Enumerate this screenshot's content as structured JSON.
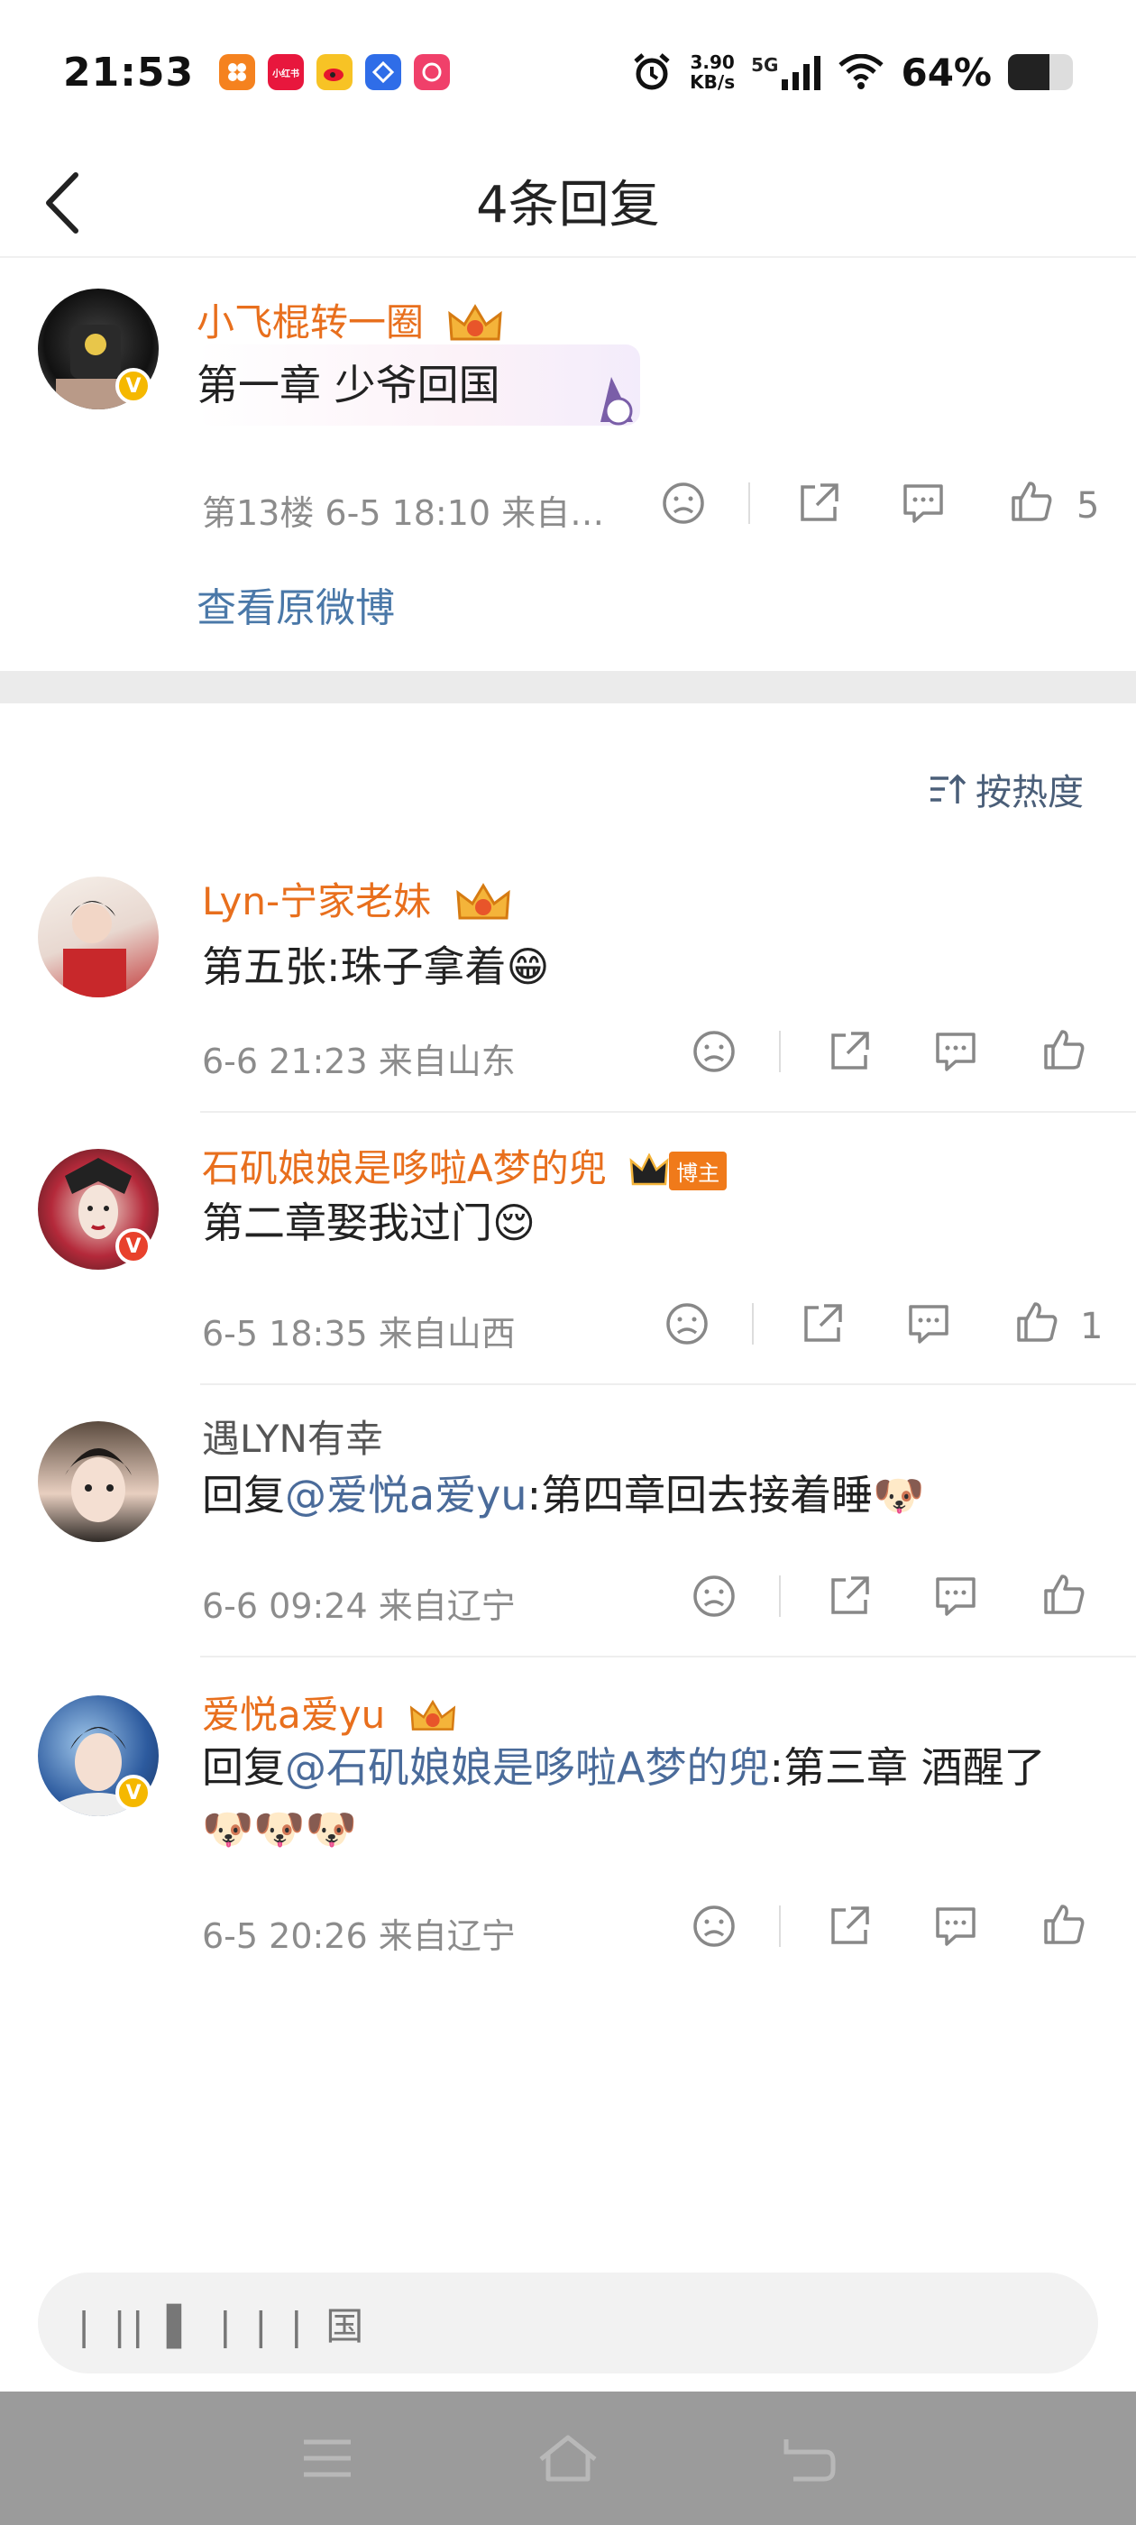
{
  "status_bar": {
    "time": "21:53",
    "net_speed_top": "3.90",
    "net_speed_bottom": "KB/s",
    "network": "5G",
    "battery": "64%",
    "battery_level": 0.64,
    "apps": [
      {
        "icon": "taobao-app-icon",
        "label": "",
        "color": "#f5821f"
      },
      {
        "icon": "xiaohongshu-app-icon",
        "label": "小红书",
        "color": "#e8173d"
      },
      {
        "icon": "weibo-app-icon",
        "label": "",
        "color": "#f7c325"
      },
      {
        "icon": "blue-app-icon",
        "label": "",
        "color": "#2f6de8"
      },
      {
        "icon": "pink-app-icon",
        "label": "",
        "color": "#f0406a"
      }
    ]
  },
  "header": {
    "title": "4条回复"
  },
  "original": {
    "username": "小飞棍转一圈",
    "content": "第一章 少爷回国",
    "meta": "第13楼 6-5 18:10 来自…",
    "likes": "5",
    "view_original": "查看原微博"
  },
  "sort_label": "按热度",
  "replies": [
    {
      "username": "Lyn-宁家老妹",
      "content_prefix": "",
      "mention": "",
      "content": "第五张:珠子拿着😁",
      "meta": "6-6 21:23  来自山东",
      "likes": ""
    },
    {
      "username": "石矶娘娘是哆啦A梦的兜",
      "blog_tag": "博主",
      "content_prefix": "",
      "mention": "",
      "content": "第二章娶我过门😌",
      "meta": "6-5 18:35  来自山西",
      "likes": "1"
    },
    {
      "username": "遇LYN有幸",
      "content_prefix": "回复",
      "mention": "@爱悦a爱yu",
      "content": ":第四章回去接着睡🐶",
      "meta": "6-6 09:24  来自辽宁",
      "likes": ""
    },
    {
      "username": "爱悦a爱yu",
      "content_prefix": "回复",
      "mention": "@石矶娘娘是哆啦A梦的兜",
      "content": ":第三章 酒醒了🐶🐶🐶",
      "meta": "6-5 20:26  来自辽宁",
      "likes": ""
    }
  ],
  "input": {
    "placeholder": "| || ▌ | | | 国"
  }
}
